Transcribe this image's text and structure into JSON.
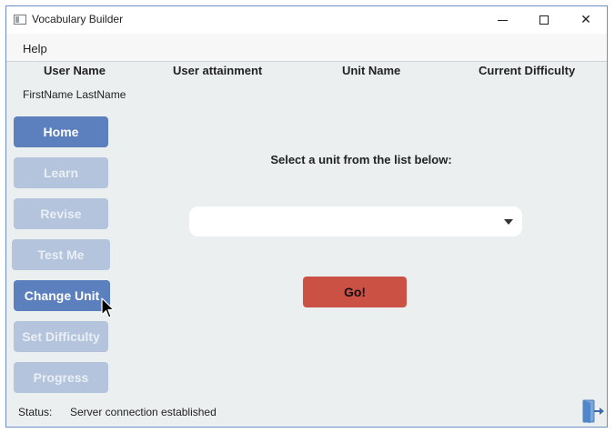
{
  "window": {
    "title": "Vocabulary Builder"
  },
  "menu": {
    "help_label": "Help"
  },
  "header": {
    "user_name": "User Name",
    "user_attainment": "User attainment",
    "unit_name": "Unit Name",
    "current_difficulty": "Current Difficulty"
  },
  "user": {
    "display_name": "FirstName LastName"
  },
  "nav": {
    "home": "Home",
    "learn": "Learn",
    "revise": "Revise",
    "test_me": "Test Me",
    "change_unit": "Change Unit",
    "set_difficulty": "Set Difficulty",
    "progress": "Progress"
  },
  "main": {
    "prompt": "Select a unit from the list below:",
    "unit_select_value": "",
    "go_label": "Go!"
  },
  "status": {
    "label": "Status:",
    "text": "Server connection established"
  },
  "colors": {
    "nav_active": "#5b80bd",
    "nav_disabled": "#b3c4dc",
    "go_button": "#cb5145",
    "background": "#eceff0"
  },
  "icons": {
    "app": "app-window-icon",
    "exit": "exit-door-icon",
    "dropdown": "chevron-down-icon"
  }
}
